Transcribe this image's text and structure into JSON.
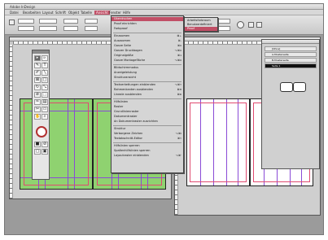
{
  "window": {
    "title": "Adobe InDesign"
  },
  "menubar": {
    "items": [
      {
        "label": "Datei"
      },
      {
        "label": "Bearbeiten"
      },
      {
        "label": "Layout"
      },
      {
        "label": "Schrift"
      },
      {
        "label": "Objekt"
      },
      {
        "label": "Tabelle"
      },
      {
        "label": "Ansicht"
      },
      {
        "label": "Fenster"
      },
      {
        "label": "Hilfe"
      }
    ]
  },
  "view_menu": {
    "items": [
      {
        "label": "Überdrucken",
        "shortcut": ""
      },
      {
        "label": "Proof einrichten",
        "shortcut": ""
      },
      {
        "label": "Farbproof",
        "shortcut": ""
      },
      {
        "label": "Einzoomen",
        "shortcut": "⌘+"
      },
      {
        "label": "Auszoomen",
        "shortcut": "⌘-"
      },
      {
        "label": "Ganze Seite",
        "shortcut": "⌘0"
      },
      {
        "label": "Ganzer Druckbogen",
        "shortcut": "⌥⌘0"
      },
      {
        "label": "Originalgröße",
        "shortcut": "⌘1"
      },
      {
        "label": "Ganze Montagefläche",
        "shortcut": "⌥⌘0"
      },
      {
        "label": "Bildschirmmodus",
        "shortcut": ""
      },
      {
        "label": "Anzeigeleistung",
        "shortcut": ""
      },
      {
        "label": "Strukturansicht",
        "shortcut": ""
      },
      {
        "label": "Textverkettungen einblenden",
        "shortcut": "⌥⌘Y"
      },
      {
        "label": "Rahmenkanten ausblenden",
        "shortcut": "⌘H"
      },
      {
        "label": "Lineale ausblenden",
        "shortcut": "⌘R"
      },
      {
        "label": "Hilfslinien",
        "shortcut": ""
      },
      {
        "label": "Raster",
        "shortcut": ""
      },
      {
        "label": "Grundlinienraster",
        "shortcut": ""
      },
      {
        "label": "Dokumentraster",
        "shortcut": ""
      },
      {
        "label": "An Dokumentraster ausrichten",
        "shortcut": ""
      },
      {
        "label": "Struktur",
        "shortcut": ""
      },
      {
        "label": "Verborgene Zeichen",
        "shortcut": "⌥⌘I"
      },
      {
        "label": "Textabschnitt-Editor",
        "shortcut": "⌘Y"
      },
      {
        "label": "Hilfslinien sperren",
        "shortcut": ""
      },
      {
        "label": "Spaltenhilfslinien sperren",
        "shortcut": ""
      },
      {
        "label": "Layoutraster einblenden",
        "shortcut": "⌥⌘'"
      }
    ]
  },
  "proof_submenu": {
    "items": [
      {
        "label": "Arbeitsfarbraum"
      },
      {
        "label": "Benutzerdefiniert"
      },
      {
        "label": "Proof"
      }
    ]
  },
  "pages_panel": {
    "rows": [
      {
        "label": "[Ohne]"
      },
      {
        "label": "A-Musterseite"
      },
      {
        "label": "B-Musterseite"
      },
      {
        "label": "Seite 1"
      }
    ]
  },
  "colors": {
    "highlight": "#c14f66",
    "guides": "#8a4bd6",
    "page_green": "#8fd270",
    "margin": "#e04a70"
  }
}
